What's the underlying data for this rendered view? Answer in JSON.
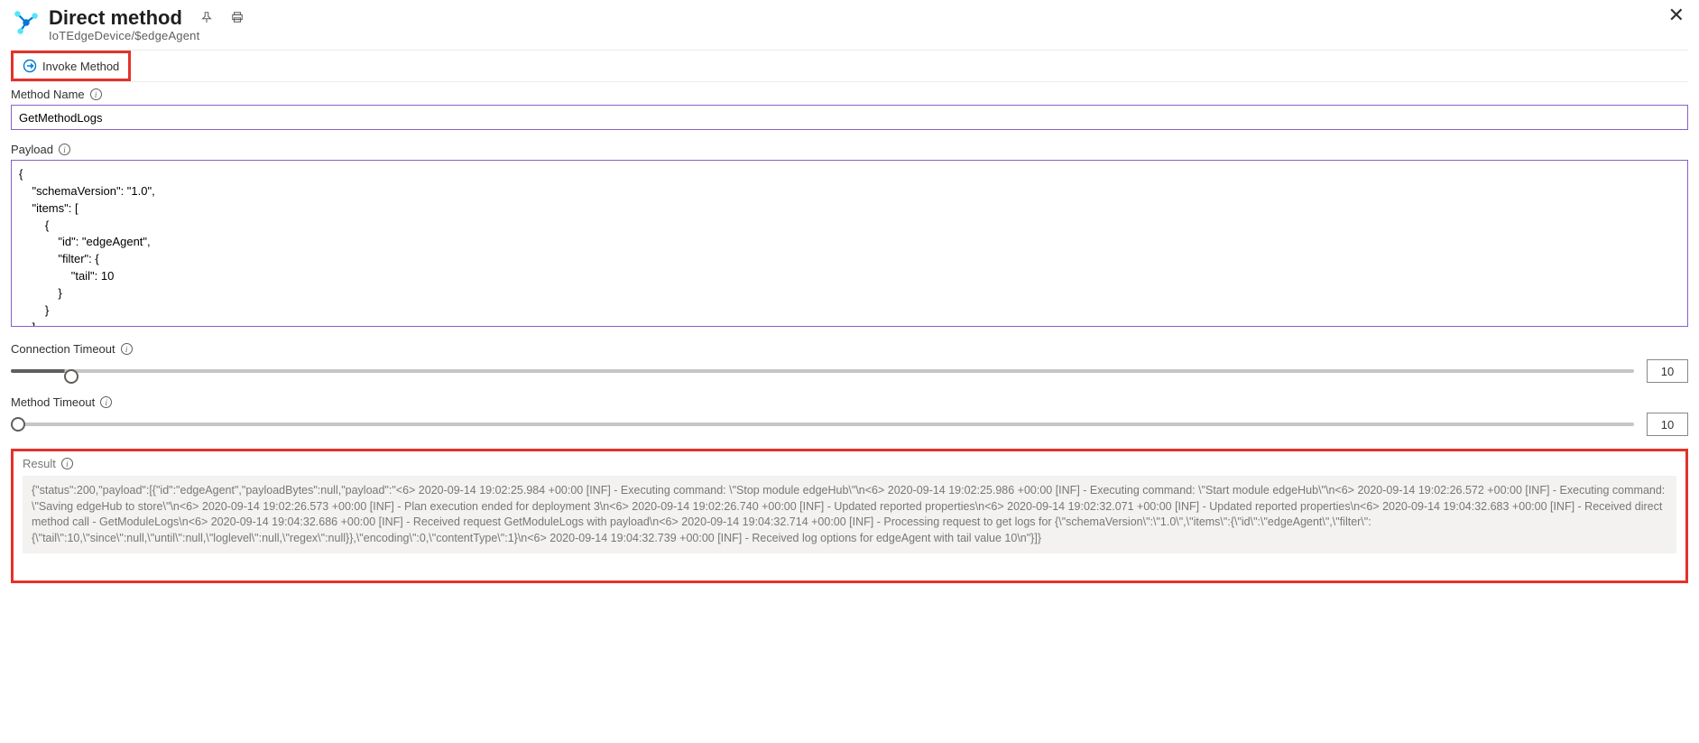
{
  "header": {
    "title": "Direct method",
    "breadcrumb": "IoTEdgeDevice/$edgeAgent"
  },
  "toolbar": {
    "invoke_label": "Invoke Method"
  },
  "fields": {
    "method_name_label": "Method Name",
    "method_name_value": "GetMethodLogs",
    "payload_label": "Payload",
    "payload_value": "{\n    \"schemaVersion\": \"1.0\",\n    \"items\": [\n        {\n            \"id\": \"edgeAgent\",\n            \"filter\": {\n                \"tail\": 10\n            }\n        }\n    ],",
    "connection_timeout_label": "Connection Timeout",
    "connection_timeout_value": "10",
    "method_timeout_label": "Method Timeout",
    "method_timeout_value": "10",
    "result_label": "Result",
    "result_value": "{\"status\":200,\"payload\":[{\"id\":\"edgeAgent\",\"payloadBytes\":null,\"payload\":\"<6> 2020-09-14 19:02:25.984 +00:00 [INF] - Executing command: \\\"Stop module edgeHub\\\"\\n<6> 2020-09-14 19:02:25.986 +00:00 [INF] - Executing command: \\\"Start module edgeHub\\\"\\n<6> 2020-09-14 19:02:26.572 +00:00 [INF] - Executing command: \\\"Saving edgeHub to store\\\"\\n<6> 2020-09-14 19:02:26.573 +00:00 [INF] - Plan execution ended for deployment 3\\n<6> 2020-09-14 19:02:26.740 +00:00 [INF] - Updated reported properties\\n<6> 2020-09-14 19:02:32.071 +00:00 [INF] - Updated reported properties\\n<6> 2020-09-14 19:04:32.683 +00:00 [INF] - Received direct method call - GetModuleLogs\\n<6> 2020-09-14 19:04:32.686 +00:00 [INF] - Received request GetModuleLogs with payload\\n<6> 2020-09-14 19:04:32.714 +00:00 [INF] - Processing request to get logs for {\\\"schemaVersion\\\":\\\"1.0\\\",\\\"items\\\":{\\\"id\\\":\\\"edgeAgent\\\",\\\"filter\\\":{\\\"tail\\\":10,\\\"since\\\":null,\\\"until\\\":null,\\\"loglevel\\\":null,\\\"regex\\\":null}},\\\"encoding\\\":0,\\\"contentType\\\":1}\\n<6> 2020-09-14 19:04:32.739 +00:00 [INF] - Received log options for edgeAgent with tail value 10\\n\"}]}"
  }
}
